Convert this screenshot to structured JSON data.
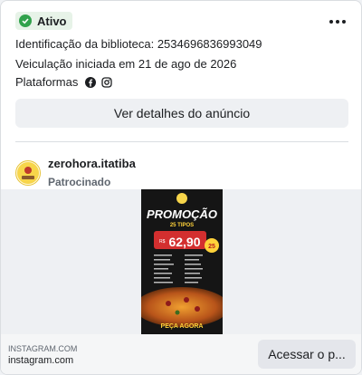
{
  "status": {
    "label": "Ativo",
    "accent": "#31a24c"
  },
  "info": {
    "library_id": "Identificação da biblioteca: 2534696836993049",
    "start_date": "Veiculação iniciada em 21 de ago de 2026",
    "platforms_label": "Plataformas",
    "platform_icons": [
      "facebook-icon",
      "instagram-icon"
    ]
  },
  "details_button": "Ver detalhes do anúncio",
  "advertiser": {
    "name": "zerohora.itatiba",
    "subtitle": "Patrocinado"
  },
  "poster": {
    "title": "PROMOÇÃO",
    "subtitle": "25 TIPOS",
    "price_prefix": "R$",
    "price": "62,90",
    "badge": "25",
    "cta": "PEÇA AGORA"
  },
  "footer": {
    "domain": "INSTAGRAM.COM",
    "site": "instagram.com",
    "cta": "Acessar o p..."
  }
}
